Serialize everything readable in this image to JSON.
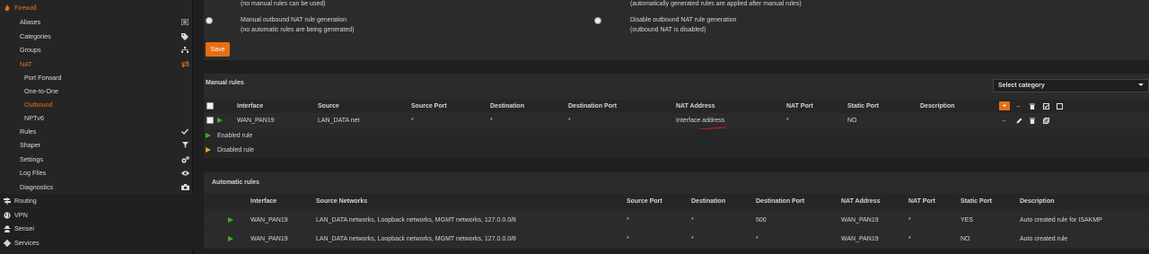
{
  "sidebar": {
    "firewall": "Firewall",
    "aliases": "Aliases",
    "categories": "Categories",
    "groups": "Groups",
    "nat": "NAT",
    "port_forward": "Port Forward",
    "one_to_one": "One-to-One",
    "outbound": "Outbound",
    "nptv6": "NPTv6",
    "rules": "Rules",
    "shaper": "Shaper",
    "settings": "Settings",
    "log_files": "Log Files",
    "diagnostics": "Diagnostics",
    "routing": "Routing",
    "vpn": "VPN",
    "sensei": "Sensei",
    "services": "Services"
  },
  "mode": {
    "opt1_note": "(no manual rules can be used)",
    "opt2_note": "(automatically generated rules are applied after manual rules)",
    "opt3_title": "Manual outbound NAT rule generation",
    "opt3_note": "(no automatic rules are being generated)",
    "opt4_title": "Disable outbound NAT rule generation",
    "opt4_note": "(outbound NAT is disabled)",
    "save": "Save"
  },
  "manual": {
    "title": "Manual rules",
    "select_category": "Select category",
    "headers": [
      "Interface",
      "Source",
      "Source Port",
      "Destination",
      "Destination Port",
      "NAT Address",
      "NAT Port",
      "Static Port",
      "Description"
    ],
    "rows": [
      {
        "interface": "WAN_PAN19",
        "source": "LAN_DATA net",
        "source_port": "*",
        "destination": "*",
        "destination_port": "*",
        "nat_address": "Interface address",
        "nat_port": "*",
        "static_port": "NO",
        "description": ""
      }
    ],
    "legend_enabled": "Enabled rule",
    "legend_disabled": "Disabled rule"
  },
  "automatic": {
    "title": "Automatic rules",
    "headers": [
      "Interface",
      "Source Networks",
      "Source Port",
      "Destination",
      "Destination Port",
      "NAT Address",
      "NAT Port",
      "Static Port",
      "Description"
    ],
    "rows": [
      {
        "interface": "WAN_PAN19",
        "source": "LAN_DATA networks, Loopback networks, MGMT networks, 127.0.0.0/8",
        "source_port": "*",
        "destination": "*",
        "destination_port": "500",
        "nat_address": "WAN_PAN19",
        "nat_port": "*",
        "static_port": "YES",
        "description": "Auto created rule for ISAKMP"
      },
      {
        "interface": "WAN_PAN19",
        "source": "LAN_DATA networks, Loopback networks, MGMT networks, 127.0.0.0/8",
        "source_port": "*",
        "destination": "*",
        "destination_port": "*",
        "nat_address": "WAN_PAN19",
        "nat_port": "*",
        "static_port": "NO",
        "description": "Auto created rule"
      }
    ]
  },
  "colors": {
    "accent": "#e66f14",
    "enabled": "#3fae1a",
    "disabled": "#e8a81b",
    "annotation": "#d42020"
  }
}
